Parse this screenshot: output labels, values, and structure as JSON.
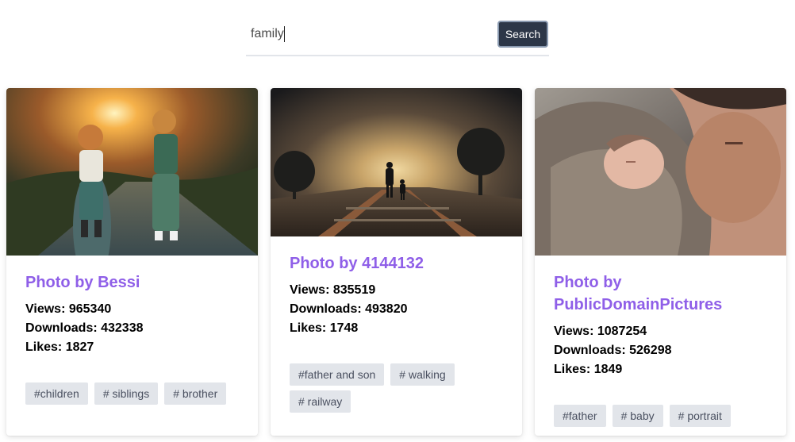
{
  "search": {
    "value": "family",
    "button_label": "Search"
  },
  "cards": [
    {
      "title": "Photo by Bessi",
      "views": "Views: 965340",
      "downloads": "Downloads: 432338",
      "likes": "Likes: 1827",
      "tags": [
        "#children",
        "# siblings",
        "# brother"
      ],
      "image_desc": "two-children-sunset"
    },
    {
      "title": "Photo by 4144132",
      "views": "Views: 835519",
      "downloads": "Downloads: 493820",
      "likes": "Likes: 1748",
      "tags": [
        "#father and son",
        "# walking",
        "# railway"
      ],
      "image_desc": "father-son-railway"
    },
    {
      "title": "Photo by PublicDomainPictures",
      "views": "Views: 1087254",
      "downloads": "Downloads: 526298",
      "likes": "Likes: 1849",
      "tags": [
        "#father",
        "# baby",
        "# portrait"
      ],
      "image_desc": "father-baby-portrait"
    }
  ],
  "colors": {
    "accent": "#8f5fe8",
    "button_bg": "#2d3748",
    "tag_bg": "#e2e5ea"
  }
}
